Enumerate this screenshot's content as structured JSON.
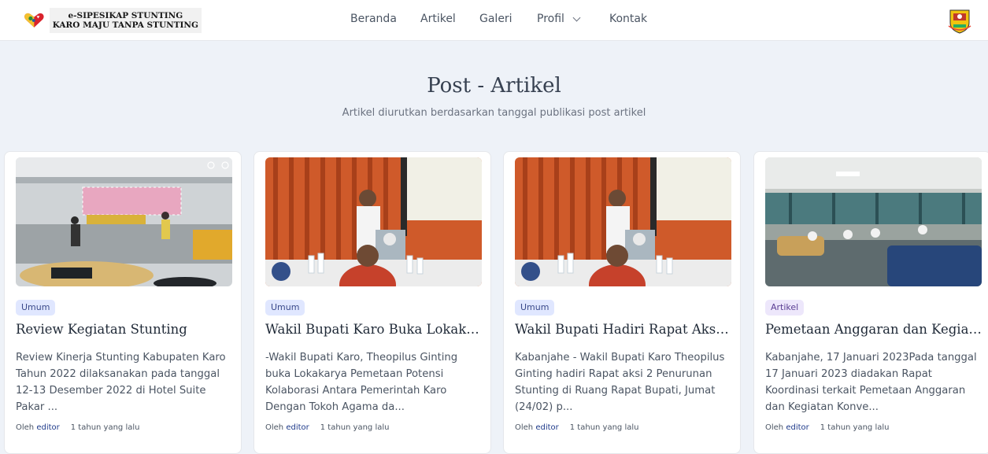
{
  "brand": {
    "line1": "e-SIPESIKAP STUNTING",
    "line2": "KARO MAJU TANPA STUNTING"
  },
  "nav": {
    "items": [
      "Beranda",
      "Artikel",
      "Galeri",
      "Profil",
      "Kontak"
    ]
  },
  "hero": {
    "title": "Post - Artikel",
    "subtitle": "Artikel diurutkan berdasarkan tanggal publikasi post artikel"
  },
  "articles": [
    {
      "category": "Umum",
      "title": "Review Kegiatan Stunting",
      "excerpt": "Review Kinerja  Stunting Kabupaten Karo Tahun 2022 dilaksanakan pada tanggal 12-13 Desember 2022 di Hotel Suite Pakar ...",
      "by": "Oleh",
      "author": "editor",
      "time": "1 tahun yang lalu"
    },
    {
      "category": "Umum",
      "title": "Wakil Bupati Karo Buka Lokakar...",
      "excerpt": "-Wakil Bupati Karo, Theopilus Ginting buka Lokakarya Pemetaan Potensi Kolaborasi Antara Pemerintah Karo Dengan Tokoh Agama da...",
      "by": "Oleh",
      "author": "editor",
      "time": "1 tahun yang lalu"
    },
    {
      "category": "Umum",
      "title": "Wakil Bupati Hadiri Rapat Aksi...",
      "excerpt": "Kabanjahe - Wakil Bupati Karo Theopilus Ginting hadiri Rapat aksi 2 Penurunan Stunting di Ruang Rapat Bupati, Jumat (24/02) p...",
      "by": "Oleh",
      "author": "editor",
      "time": "1 tahun yang lalu"
    },
    {
      "category": "Artikel",
      "title": "Pemetaan Anggaran dan Kegiatan...",
      "excerpt": "Kabanjahe, 17 Januari 2023Pada tanggal 17 Januari 2023 diadakan Rapat Koordinasi terkait Pemetaan Anggaran dan Kegiatan Konve...",
      "by": "Oleh",
      "author": "editor",
      "time": "1 tahun yang lalu"
    }
  ],
  "colors": {
    "background": "#eef2f8",
    "card": "#ffffff",
    "tag_umum": "#e0e7ff",
    "tag_artikel": "#ede7fb",
    "author_link": "#1e3a8a"
  }
}
